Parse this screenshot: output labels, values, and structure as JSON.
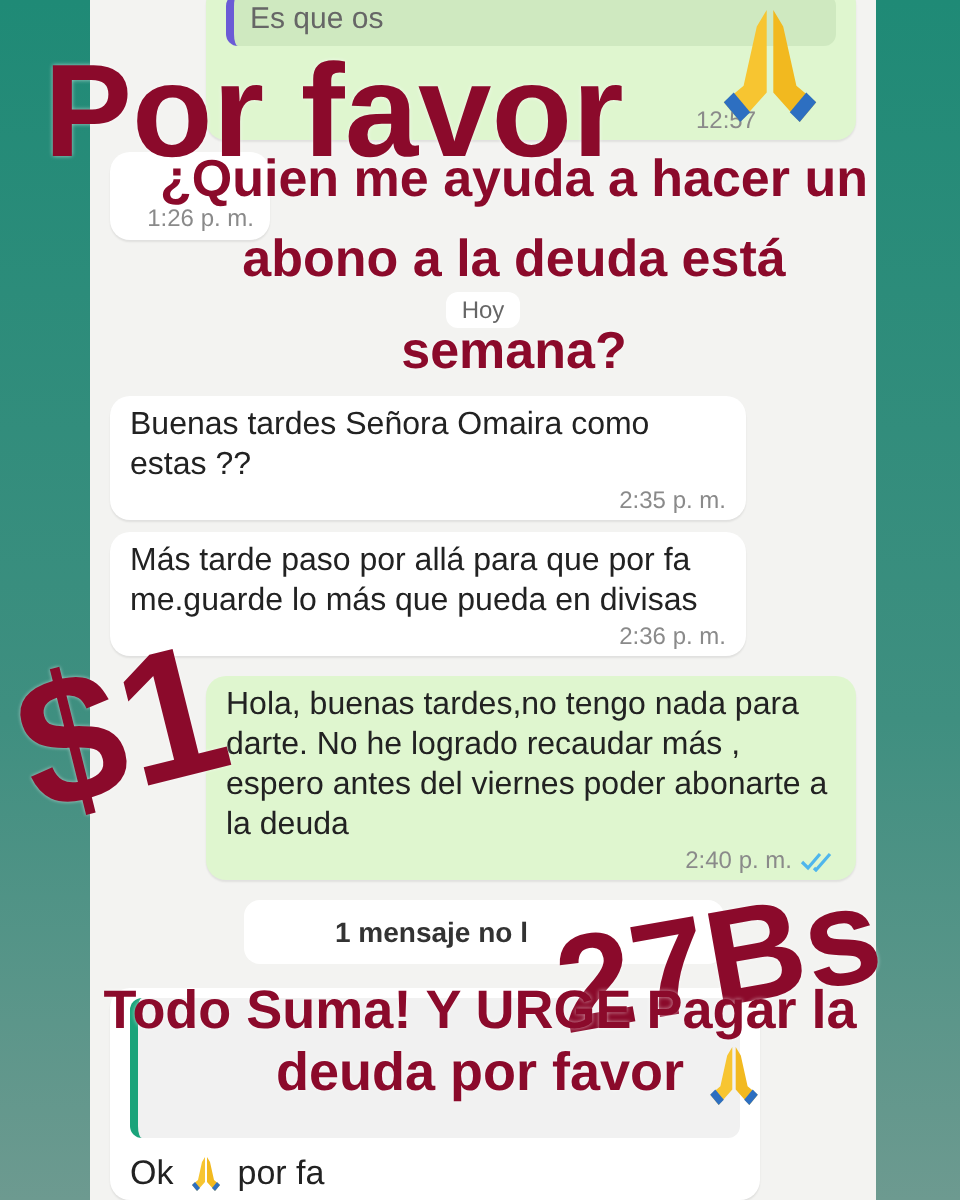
{
  "messages": [
    {
      "kind": "outgoing_quote",
      "quote": "Es que os",
      "time": "12:57"
    },
    {
      "kind": "incoming",
      "time": "1:26 p. m."
    },
    {
      "kind": "date",
      "text": "Hoy"
    },
    {
      "kind": "incoming",
      "text": "Buenas tardes Señora Omaira como estas ??",
      "time": "2:35 p. m."
    },
    {
      "kind": "incoming",
      "text": "Más tarde paso por allá para que por fa me.guarde lo más que pueda en divisas",
      "time": "2:36 p. m."
    },
    {
      "kind": "outgoing",
      "text": "Hola, buenas tardes,no tengo nada para darte. No he logrado recaudar más , espero antes del viernes poder abonarte a la deuda",
      "time": "2:40 p. m.",
      "read": true
    },
    {
      "kind": "unread",
      "text": "1 mensaje no l"
    },
    {
      "kind": "reply",
      "text_before": "Ok",
      "text_after": "por fa"
    }
  ],
  "overlay": {
    "title": "Por favor",
    "question": [
      "¿Quien me ayuda a hacer un",
      "abono a la deuda está",
      "semana?"
    ],
    "amount_usd": "$1",
    "amount_bs": "27Bs",
    "footer": [
      "Todo Suma! Y URGE Pagar la",
      "deuda por favor"
    ]
  }
}
